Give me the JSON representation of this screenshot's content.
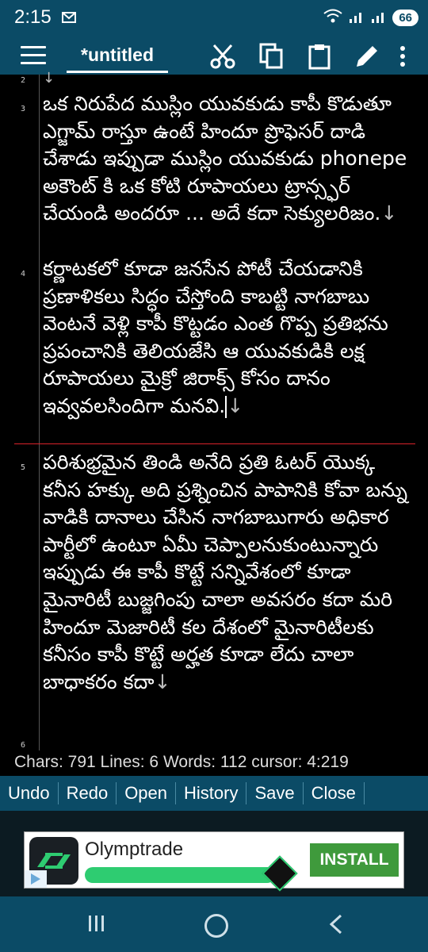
{
  "status": {
    "time": "2:15",
    "battery": "66"
  },
  "toolbar": {
    "tab_title": "*untitled"
  },
  "editor": {
    "lines": [
      {
        "num": "2",
        "text": ""
      },
      {
        "num": "3",
        "text": "ఒక నిరుపేద ముస్లిం యువకుడు కాపీ కొడుతూ ఎగ్జామ్ రాస్తూ ఉంటే హిందూ ప్రొఫెసర్ దాడి చేశాడు ఇప్పుడా ముస్లిం యువకుడు phonepe అకౌంట్ కి ఒక కోటి రూపాయలు ట్రాన్స్ఫర్ చేయండి అందరూ ... అదే కదా సెక్యులరిజం."
      },
      {
        "num": "4",
        "text": "కర్ణాటకలో కూడా జనసేన పోటీ చేయడానికి ప్రణాళికలు సిద్ధం చేస్తోంది కాబట్టి నాగబాబు వెంటనే వెళ్లి కాపీ కొట్టడం ఎంత గొప్ప ప్రతిభను ప్రపంచానికి తెలియజేసి ఆ యువకుడికి లక్ష రూపాయలు మైక్రో జిరాక్స్ కోసం దానం ఇవ్వవలసిందిగా మనవి."
      },
      {
        "num": "5",
        "text": "పరిశుభ్రమైన తిండి అనేది ప్రతి ఓటర్ యొక్క కనీస హక్కు అది ప్రశ్నించిన పాపానికి కోవా బన్ను వాడికి దానాలు చేసిన నాగబాబుగారు అధికార పార్టీలో ఉంటూ ఏమీ చెప్పాలనుకుంటున్నారు ఇప్పుడు ఈ కాపీ కొట్టే సన్నివేశంలో కూడా మైనారిటీ బుజ్జగింపు చాలా అవసరం కదా మరి హిందూ మెజారిటీ కల దేశంలో మైనారిటీలకు కనీసం కాపీ కొట్టే అర్హత కూడా లేదు చాలా బాధాకరం కదా"
      },
      {
        "num": "6",
        "text": ""
      }
    ],
    "eol_mark": "↓"
  },
  "stats": {
    "text": "Chars: 791  Lines: 6  Words: 112  cursor: 4:219"
  },
  "actions": [
    "Undo",
    "Redo",
    "Open",
    "History",
    "Save",
    "Close"
  ],
  "ad": {
    "title": "Olymptrade",
    "button": "INSTALL"
  }
}
